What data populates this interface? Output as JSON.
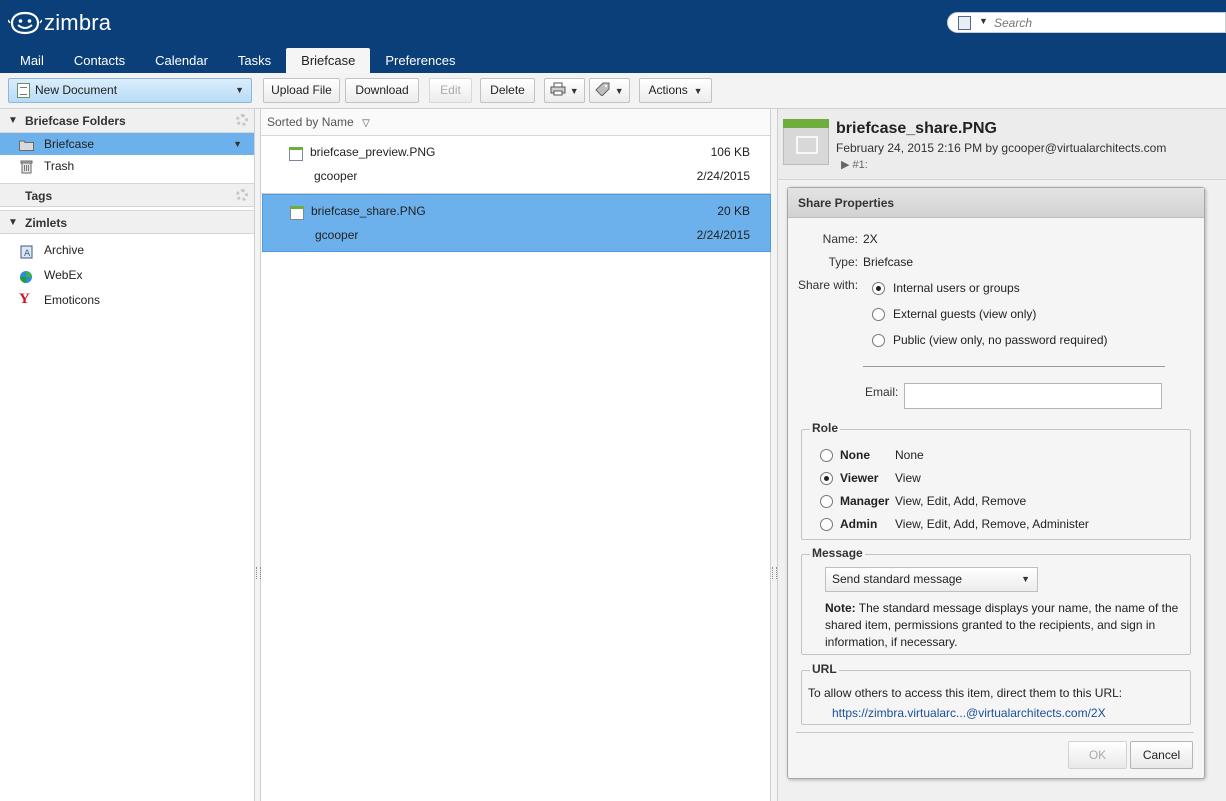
{
  "app": {
    "logo_text": "zimbra"
  },
  "search": {
    "placeholder": "Search"
  },
  "app_tabs": [
    "Mail",
    "Contacts",
    "Calendar",
    "Tasks",
    "Briefcase",
    "Preferences"
  ],
  "active_tab": "Briefcase",
  "toolbar": {
    "new_document": "New Document",
    "upload_file": "Upload File",
    "download": "Download",
    "edit": "Edit",
    "delete": "Delete",
    "actions": "Actions"
  },
  "sidebar": {
    "briefcase_folders": "Briefcase Folders",
    "folders": [
      {
        "label": "Briefcase",
        "selected": true,
        "icon": "folder-icon"
      },
      {
        "label": "Trash",
        "selected": false,
        "icon": "trash-icon"
      }
    ],
    "tags": "Tags",
    "zimlets": "Zimlets",
    "zimlet_items": [
      {
        "label": "Archive",
        "icon": "archive-icon"
      },
      {
        "label": "WebEx",
        "icon": "webex-icon"
      },
      {
        "label": "Emoticons",
        "icon": "emoticons-icon"
      }
    ]
  },
  "list": {
    "sort_label": "Sorted by Name",
    "items": [
      {
        "name": "briefcase_preview.PNG",
        "size": "106 KB",
        "owner": "gcooper",
        "date": "2/24/2015",
        "selected": false
      },
      {
        "name": "briefcase_share.PNG",
        "size": "20 KB",
        "owner": "gcooper",
        "date": "2/24/2015",
        "selected": true
      }
    ]
  },
  "preview": {
    "title": "briefcase_share.PNG",
    "meta": "February 24, 2015 2:16 PM by gcooper@virtualarchitects.com",
    "version": "▶ #1:"
  },
  "dialog": {
    "title": "Share Properties",
    "name_label": "Name:",
    "name_value": "2X",
    "type_label": "Type:",
    "type_value": "Briefcase",
    "share_with_label": "Share with:",
    "share_options": [
      {
        "label": "Internal users or groups",
        "checked": true
      },
      {
        "label": "External guests (view only)",
        "checked": false
      },
      {
        "label": "Public (view only, no password required)",
        "checked": false
      }
    ],
    "email_label": "Email:",
    "email_value": "",
    "role_legend": "Role",
    "roles": [
      {
        "name": "None",
        "desc": "None",
        "checked": false
      },
      {
        "name": "Viewer",
        "desc": "View",
        "checked": true
      },
      {
        "name": "Manager",
        "desc": "View, Edit, Add, Remove",
        "checked": false
      },
      {
        "name": "Admin",
        "desc": "View, Edit, Add, Remove, Administer",
        "checked": false
      }
    ],
    "message_legend": "Message",
    "message_select": "Send standard message",
    "note_bold": "Note:",
    "note_text": "The standard message displays your name, the name of the shared item, permissions granted to the recipients, and sign in information, if necessary.",
    "url_legend": "URL",
    "url_text": "To allow others to access this item, direct them to this URL:",
    "url_link": "https://zimbra.virtualarc...@virtualarchitects.com/2X",
    "ok": "OK",
    "cancel": "Cancel"
  },
  "colors": {
    "header_bg": "#0b3f7a",
    "selection": "#6cb1ec",
    "link": "#1a4f9a"
  }
}
